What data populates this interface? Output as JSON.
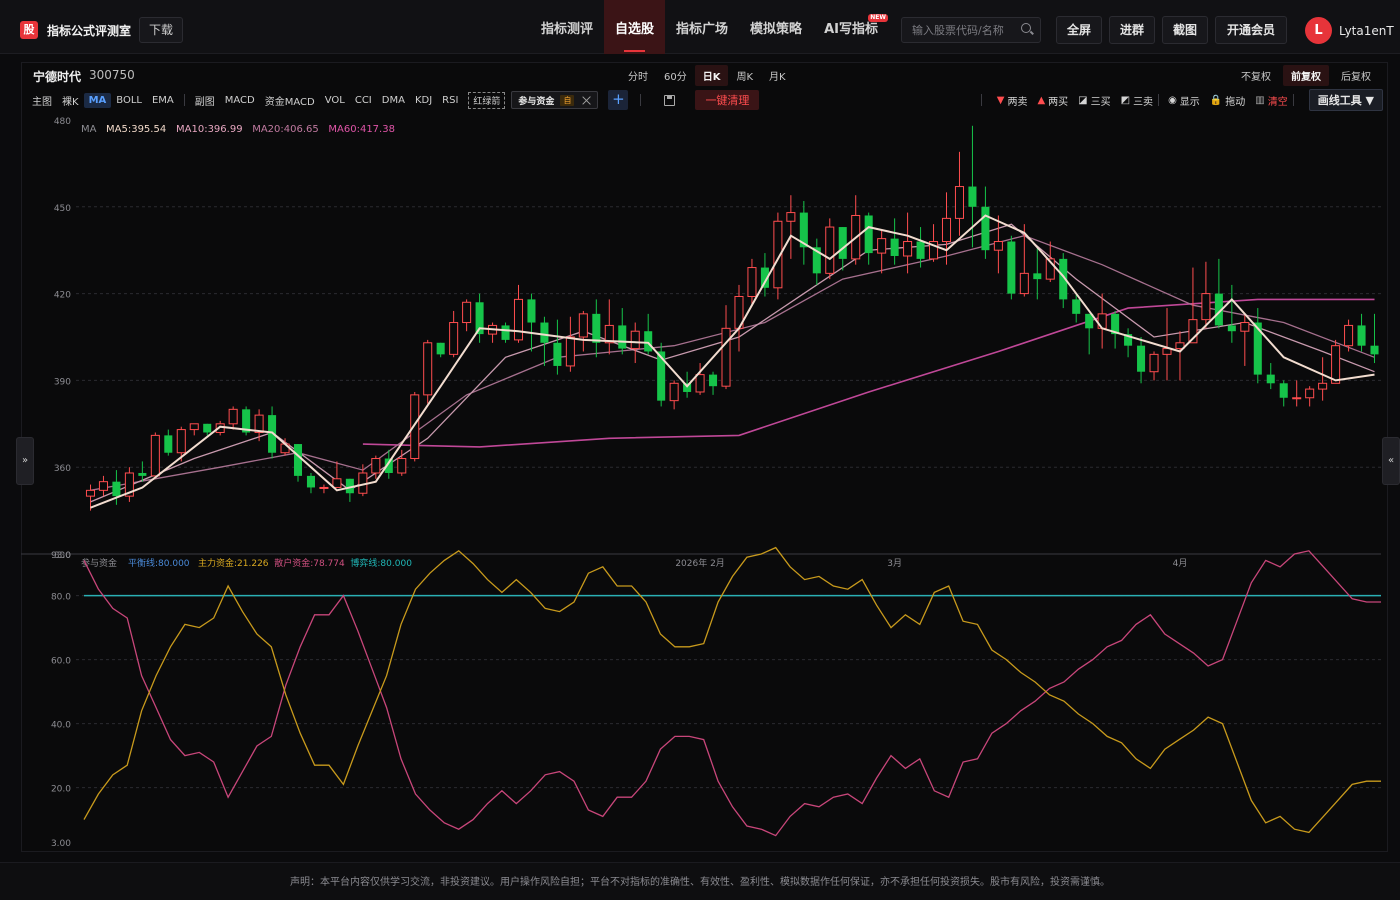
{
  "header": {
    "logo_char": "股",
    "brand": "指标公式评测室",
    "download": "下载",
    "nav": [
      {
        "label": "指标测评",
        "active": false
      },
      {
        "label": "自选股",
        "active": true
      },
      {
        "label": "指标广场",
        "active": false
      },
      {
        "label": "模拟策略",
        "active": false
      },
      {
        "label": "AI写指标",
        "active": false,
        "badge": "NEW"
      }
    ],
    "search_placeholder": "输入股票代码/名称",
    "buttons": [
      "全屏",
      "进群",
      "截图",
      "开通会员"
    ],
    "avatar_letter": "L",
    "username": "Lyta1enT"
  },
  "stock": {
    "name": "宁德时代",
    "code": "300750"
  },
  "periods": [
    {
      "label": "分时",
      "active": false
    },
    {
      "label": "60分",
      "active": false
    },
    {
      "label": "日K",
      "active": true
    },
    {
      "label": "周K",
      "active": false
    },
    {
      "label": "月K",
      "active": false
    }
  ],
  "adjust": [
    {
      "label": "不复权",
      "active": false
    },
    {
      "label": "前复权",
      "active": true
    },
    {
      "label": "后复权",
      "active": false
    }
  ],
  "indicators_main": [
    {
      "label": "主图",
      "active": false
    },
    {
      "label": "裸K",
      "active": false
    },
    {
      "label": "MA",
      "active": true
    },
    {
      "label": "BOLL",
      "active": false
    },
    {
      "label": "EMA",
      "active": false
    }
  ],
  "indicators_sub": [
    "副图",
    "MACD",
    "资金MACD",
    "VOL",
    "CCI",
    "DMA",
    "KDJ",
    "RSI"
  ],
  "hongluzhu": "红绿箭",
  "active_tag": {
    "label": "参与资金",
    "badge": "自"
  },
  "plus": "+",
  "clear_label": "一键清理",
  "right_tools": [
    {
      "icon": "▼",
      "label": "两卖",
      "color": "#ff4d4f"
    },
    {
      "icon": "▲",
      "label": "两买",
      "color": "#ff4d4f"
    },
    {
      "icon": "◪",
      "label": "三买",
      "color": "#cfcfcf"
    },
    {
      "icon": "◩",
      "label": "三卖",
      "color": "#cfcfcf"
    },
    {
      "icon": "◉",
      "label": "显示",
      "color": "#cfcfcf"
    },
    {
      "icon": "🔒",
      "label": "拖动",
      "color": "#e0c040"
    },
    {
      "icon": "▥",
      "label": "清空",
      "color": "#ff4d4f"
    }
  ],
  "draw_tools": "画线工具 ▼",
  "side_left": "»",
  "side_right": "«",
  "footer": "声明：本平台内容仅供学习交流，非投资建议。用户操作风险自担；平台不对指标的准确性、有效性、盈利性、模拟数据作任何保证，亦不承担任何投资损失。股市有风险，投资需谨慎。",
  "chart_data": [
    {
      "type": "candlestick",
      "ylim": [
        330,
        480
      ],
      "yticks": [
        "480",
        "450",
        "420",
        "390",
        "360",
        "330"
      ],
      "legend_prefix": "MA",
      "legend": [
        {
          "label": "MA5:395.54",
          "color": "#f0d8c8"
        },
        {
          "label": "MA10:396.99",
          "color": "#e6a6c0"
        },
        {
          "label": "MA20:406.65",
          "color": "#c07aa0"
        },
        {
          "label": "MA60:417.38",
          "color": "#e055a8"
        }
      ],
      "candles": [
        [
          350,
          352,
          345,
          354
        ],
        [
          352,
          355,
          350,
          357
        ],
        [
          355,
          350,
          347,
          359
        ],
        [
          350,
          358,
          348,
          360
        ],
        [
          358,
          357,
          355,
          362
        ],
        [
          357,
          371,
          356,
          372
        ],
        [
          371,
          365,
          364,
          373
        ],
        [
          365,
          373,
          362,
          374
        ],
        [
          373,
          375,
          371,
          375
        ],
        [
          375,
          372,
          371,
          375
        ],
        [
          372,
          375,
          371,
          376
        ],
        [
          375,
          380,
          373,
          381
        ],
        [
          380,
          372,
          371,
          381
        ],
        [
          372,
          378,
          369,
          380
        ],
        [
          378,
          365,
          363,
          381
        ],
        [
          365,
          368,
          364,
          370
        ],
        [
          368,
          357,
          355,
          368
        ],
        [
          357,
          353,
          351,
          358
        ],
        [
          353,
          353,
          351,
          354
        ],
        [
          353,
          356,
          353,
          362
        ],
        [
          356,
          351,
          348,
          356
        ],
        [
          351,
          358,
          350,
          361
        ],
        [
          358,
          363,
          356,
          364
        ],
        [
          363,
          358,
          356,
          366
        ],
        [
          358,
          363,
          357,
          366
        ],
        [
          363,
          385,
          362,
          386
        ],
        [
          385,
          403,
          382,
          404
        ],
        [
          403,
          399,
          398,
          403
        ],
        [
          399,
          410,
          398,
          414
        ],
        [
          410,
          417,
          407,
          418
        ],
        [
          417,
          406,
          403,
          420
        ],
        [
          406,
          409,
          403,
          410
        ],
        [
          409,
          404,
          403,
          410
        ],
        [
          404,
          418,
          403,
          423
        ],
        [
          418,
          410,
          400,
          420
        ],
        [
          410,
          403,
          395,
          412
        ],
        [
          403,
          395,
          392,
          411
        ],
        [
          395,
          405,
          393,
          412
        ],
        [
          405,
          413,
          400,
          414
        ],
        [
          413,
          403,
          398,
          418
        ],
        [
          403,
          409,
          399,
          418
        ],
        [
          409,
          401,
          399,
          415
        ],
        [
          401,
          407,
          396,
          410
        ],
        [
          407,
          400,
          399,
          413
        ],
        [
          400,
          383,
          381,
          403
        ],
        [
          383,
          389,
          380,
          390
        ],
        [
          389,
          386,
          384,
          393
        ],
        [
          386,
          392,
          385,
          396
        ],
        [
          392,
          388,
          385,
          393
        ],
        [
          388,
          408,
          387,
          416
        ],
        [
          408,
          419,
          400,
          423
        ],
        [
          419,
          429,
          416,
          432
        ],
        [
          429,
          422,
          419,
          434
        ],
        [
          422,
          445,
          418,
          448
        ],
        [
          445,
          448,
          432,
          454
        ],
        [
          448,
          436,
          430,
          452
        ],
        [
          436,
          427,
          423,
          439
        ],
        [
          427,
          443,
          425,
          446
        ],
        [
          443,
          432,
          428,
          443
        ],
        [
          432,
          447,
          430,
          454
        ],
        [
          447,
          434,
          430,
          448
        ],
        [
          434,
          439,
          427,
          442
        ],
        [
          439,
          433,
          430,
          446
        ],
        [
          433,
          438,
          427,
          448
        ],
        [
          438,
          432,
          429,
          443
        ],
        [
          432,
          438,
          431,
          444
        ],
        [
          438,
          446,
          430,
          455
        ],
        [
          446,
          457,
          440,
          469
        ],
        [
          457,
          450,
          436,
          478
        ],
        [
          450,
          435,
          432,
          457
        ],
        [
          435,
          438,
          427,
          447
        ],
        [
          438,
          420,
          418,
          440
        ],
        [
          420,
          427,
          419,
          444
        ],
        [
          427,
          425,
          418,
          436
        ],
        [
          425,
          432,
          424,
          438
        ],
        [
          432,
          418,
          415,
          434
        ],
        [
          418,
          413,
          410,
          420
        ],
        [
          413,
          408,
          399,
          413
        ],
        [
          408,
          413,
          401,
          420
        ],
        [
          413,
          406,
          401,
          414
        ],
        [
          406,
          402,
          398,
          408
        ],
        [
          402,
          393,
          389,
          405
        ],
        [
          393,
          399,
          390,
          400
        ],
        [
          399,
          401,
          390,
          415
        ],
        [
          401,
          403,
          390,
          407
        ],
        [
          403,
          411,
          405,
          429
        ],
        [
          411,
          420,
          408,
          431
        ],
        [
          420,
          409,
          408,
          432
        ],
        [
          409,
          407,
          403,
          423
        ],
        [
          407,
          410,
          395,
          413
        ],
        [
          410,
          392,
          389,
          415
        ],
        [
          392,
          389,
          387,
          396
        ],
        [
          389,
          384,
          381,
          390
        ],
        [
          384,
          384,
          381,
          390
        ],
        [
          384,
          387,
          381,
          388
        ],
        [
          387,
          389,
          383,
          398
        ],
        [
          389,
          402,
          398,
          404
        ],
        [
          402,
          409,
          400,
          411
        ],
        [
          409,
          402,
          400,
          413
        ],
        [
          402,
          399,
          396,
          413
        ]
      ],
      "ma5": [
        [
          0,
          346
        ],
        [
          4,
          353
        ],
        [
          10,
          374
        ],
        [
          14,
          372
        ],
        [
          19,
          352
        ],
        [
          22,
          355
        ],
        [
          27,
          388
        ],
        [
          30,
          408
        ],
        [
          33,
          407
        ],
        [
          38,
          404
        ],
        [
          43,
          403
        ],
        [
          46,
          388
        ],
        [
          50,
          408
        ],
        [
          54,
          440
        ],
        [
          57,
          432
        ],
        [
          60,
          443
        ],
        [
          63,
          440
        ],
        [
          66,
          435
        ],
        [
          69,
          447
        ],
        [
          72,
          441
        ],
        [
          75,
          426
        ],
        [
          78,
          408
        ],
        [
          81,
          404
        ],
        [
          84,
          400
        ],
        [
          88,
          418
        ],
        [
          92,
          398
        ],
        [
          96,
          390
        ],
        [
          99,
          392
        ]
      ],
      "ma10": [
        [
          0,
          348
        ],
        [
          8,
          363
        ],
        [
          14,
          372
        ],
        [
          20,
          352
        ],
        [
          26,
          370
        ],
        [
          32,
          398
        ],
        [
          38,
          407
        ],
        [
          44,
          397
        ],
        [
          50,
          405
        ],
        [
          55,
          420
        ],
        [
          60,
          435
        ],
        [
          66,
          437
        ],
        [
          71,
          444
        ],
        [
          76,
          425
        ],
        [
          82,
          405
        ],
        [
          89,
          410
        ],
        [
          95,
          400
        ],
        [
          99,
          393
        ]
      ],
      "ma20": [
        [
          0,
          352
        ],
        [
          10,
          360
        ],
        [
          16,
          365
        ],
        [
          21,
          359
        ],
        [
          29,
          385
        ],
        [
          36,
          398
        ],
        [
          45,
          402
        ],
        [
          52,
          410
        ],
        [
          58,
          425
        ],
        [
          66,
          433
        ],
        [
          72,
          440
        ],
        [
          78,
          430
        ],
        [
          85,
          416
        ],
        [
          92,
          410
        ],
        [
          99,
          398
        ]
      ],
      "ma60": [
        [
          21,
          368
        ],
        [
          30,
          367
        ],
        [
          40,
          370
        ],
        [
          50,
          371
        ],
        [
          60,
          386
        ],
        [
          70,
          400
        ],
        [
          80,
          415
        ],
        [
          90,
          418
        ],
        [
          99,
          418
        ]
      ]
    },
    {
      "type": "line",
      "title": "参与资金",
      "ylim": [
        3.0,
        93.0
      ],
      "yticks": [
        "93.0",
        "80.0",
        "60.0",
        "40.0",
        "20.0",
        "3.00"
      ],
      "x_labels": [
        {
          "i": 47,
          "label": "2026年 2月"
        },
        {
          "i": 62,
          "label": "3月"
        },
        {
          "i": 84,
          "label": "4月"
        }
      ],
      "series": [
        {
          "name": "平衡线",
          "label": "平衡线:80.000",
          "color": "#4a8ad8",
          "values_const": 80.0
        },
        {
          "name": "主力资金",
          "label": "主力资金:21.226",
          "color": "#d8a820"
        },
        {
          "name": "散户资金",
          "label": "散户资金:78.774",
          "color": "#d05080"
        },
        {
          "name": "博弈线",
          "label": "博弈线:80.000",
          "color": "#20b8b8",
          "values_const": 80.0
        }
      ],
      "main": [
        10,
        18,
        24,
        27,
        44,
        55,
        64,
        71,
        70,
        73,
        83,
        75,
        68,
        64,
        49,
        37,
        27,
        27,
        21,
        33,
        44,
        55,
        71,
        82,
        87,
        91,
        94,
        90,
        85,
        81,
        85,
        81,
        76,
        75,
        78,
        87,
        89,
        83,
        83,
        78,
        68,
        64,
        64,
        65,
        78,
        86,
        92,
        93,
        95,
        89,
        85,
        86,
        83,
        82,
        85,
        77,
        70,
        74,
        71,
        81,
        83,
        72,
        71,
        63,
        60,
        56,
        53,
        49,
        47,
        43,
        40,
        36,
        34,
        29,
        26,
        32,
        35,
        38,
        42,
        40,
        28,
        16,
        9,
        11,
        7,
        6,
        11,
        16,
        21,
        22,
        22
      ],
      "retail": [
        91,
        82,
        76,
        73,
        55,
        45,
        35,
        30,
        31,
        28,
        17,
        25,
        33,
        36,
        52,
        64,
        74,
        74,
        80,
        69,
        57,
        45,
        29,
        18,
        13,
        9,
        7,
        10,
        15,
        19,
        15,
        19,
        24,
        25,
        22,
        13,
        11,
        17,
        17,
        22,
        32,
        36,
        36,
        35,
        22,
        14,
        8,
        7,
        5,
        11,
        15,
        14,
        17,
        18,
        15,
        23,
        30,
        26,
        29,
        19,
        17,
        28,
        29,
        37,
        40,
        44,
        47,
        51,
        53,
        57,
        60,
        64,
        66,
        71,
        74,
        68,
        65,
        62,
        58,
        60,
        72,
        84,
        91,
        89,
        93,
        94,
        89,
        84,
        79,
        78,
        78
      ]
    }
  ]
}
